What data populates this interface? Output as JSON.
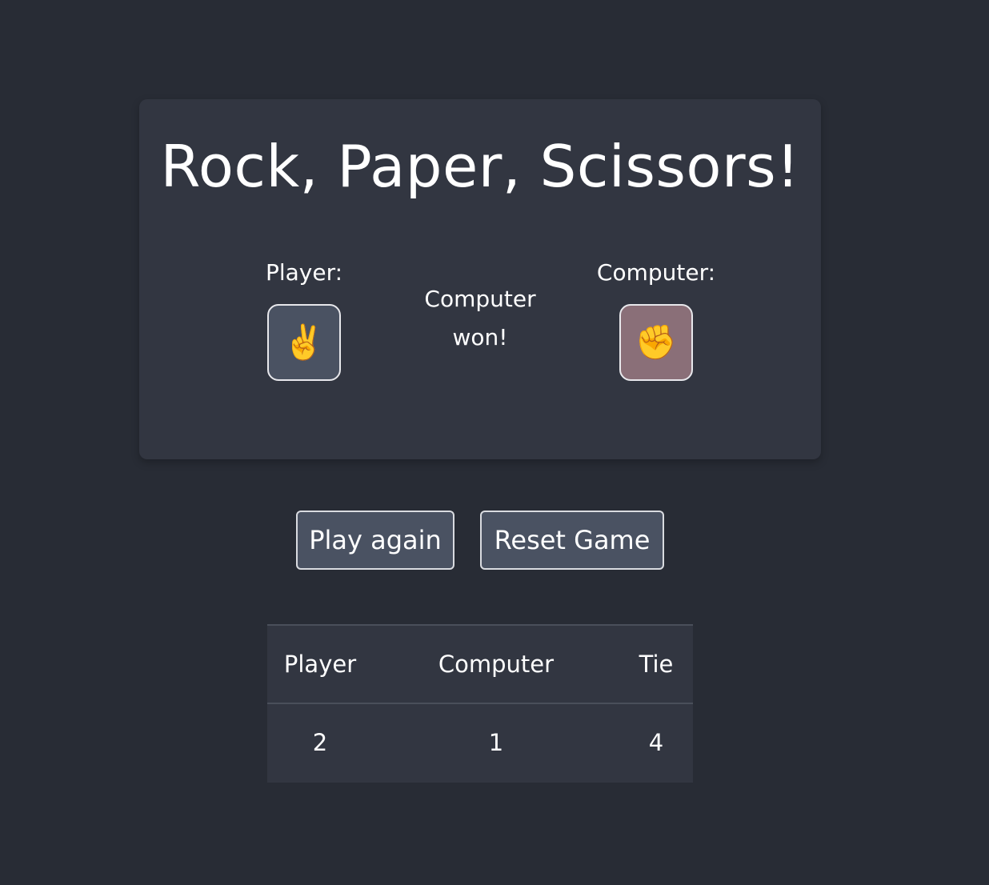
{
  "game": {
    "title": "Rock, Paper, Scissors!",
    "player_label": "Player:",
    "computer_label": "Computer:",
    "player_choice_icon": "victory-hand",
    "player_choice_glyph": "✌️",
    "computer_choice_icon": "raised-fist",
    "computer_choice_glyph": "✊",
    "result_line1": "Computer",
    "result_line2": "won!",
    "computer_highlight_color": "#8a6f78"
  },
  "actions": {
    "play_again_label": "Play again",
    "reset_label": "Reset Game"
  },
  "scoreboard": {
    "headers": [
      "Player",
      "Computer",
      "Tie"
    ],
    "values": [
      "2",
      "1",
      "4"
    ]
  }
}
